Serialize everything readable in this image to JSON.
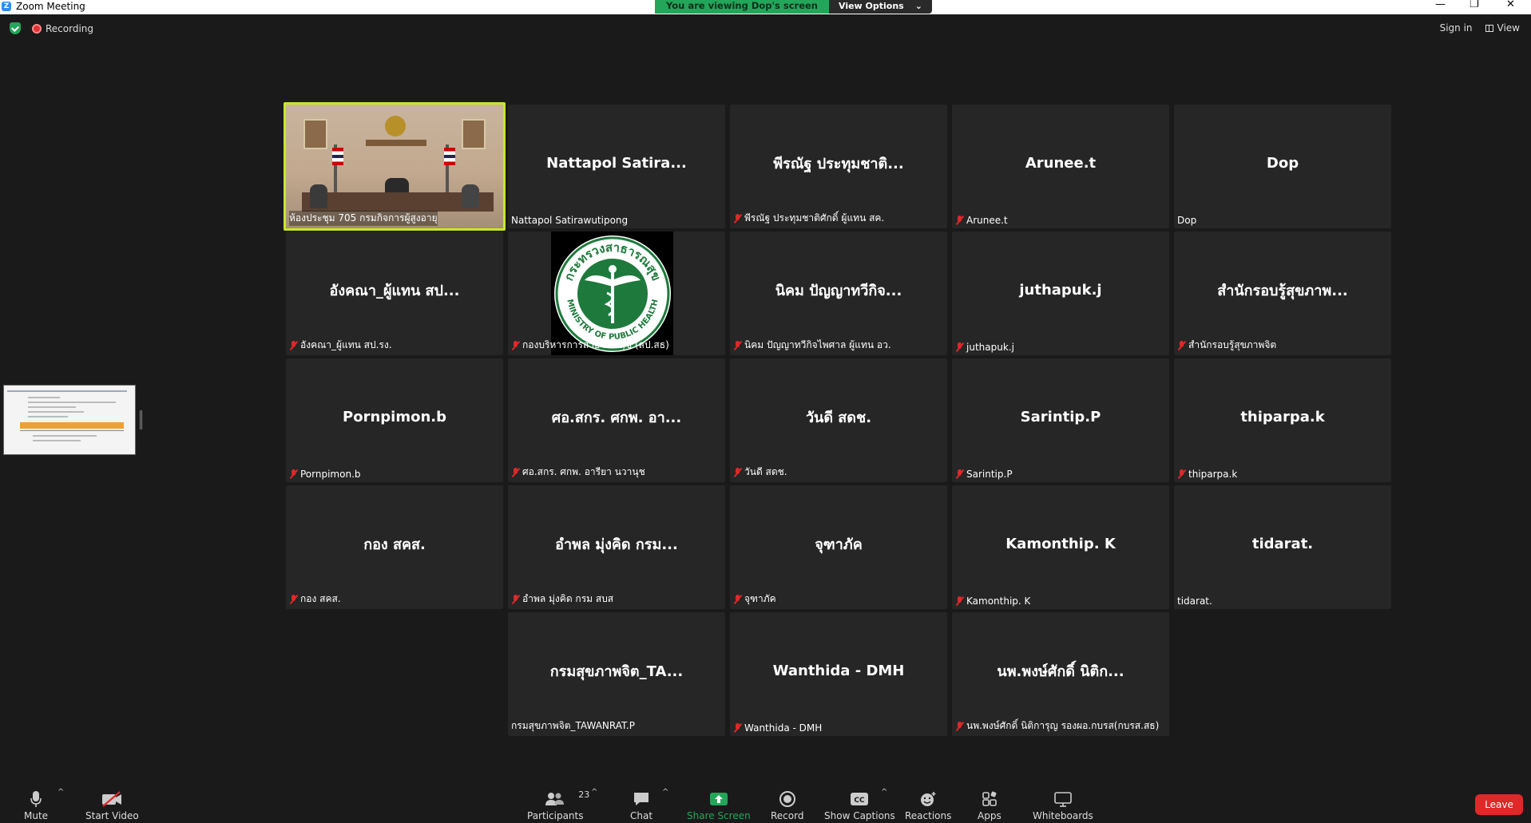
{
  "window": {
    "title": "Zoom Meeting"
  },
  "banner": {
    "viewing": "You are viewing Dop's screen",
    "view_options": "View Options",
    "chevron": "⌄"
  },
  "topbar": {
    "recording": "Recording",
    "sign_in": "Sign in",
    "view": "View"
  },
  "tiles": [
    {
      "big": "",
      "name": "ห้องประชุม 705 กรมกิจการผู้สูงอายุ",
      "muted": false,
      "video": "room"
    },
    {
      "big": "Nattapol Satira...",
      "name": "Nattapol Satirawutipong",
      "muted": false
    },
    {
      "big": "พีรณัฐ ประทุมชาติ...",
      "name": "พีรณัฐ ประทุมชาติศักดิ์ ผู้แทน สค.",
      "muted": true
    },
    {
      "big": "Arunee.t",
      "name": "Arunee.t",
      "muted": true
    },
    {
      "big": "Dop",
      "name": "Dop",
      "muted": false
    },
    {
      "big": "อังคณา_ผู้แทน สป...",
      "name": "อังคณา_ผู้แทน สป.รง.",
      "muted": true
    },
    {
      "big": "",
      "name": "กองบริหารการสาธารณสุข (สป.สธ)",
      "muted": true,
      "video": "logo"
    },
    {
      "big": "นิคม ปัญญาทวีกิจ...",
      "name": "นิคม ปัญญาทวีกิจไพศาล ผู้แทน อว.",
      "muted": true
    },
    {
      "big": "juthapuk.j",
      "name": "juthapuk.j",
      "muted": true
    },
    {
      "big": "สำนักรอบรู้สุขภาพ...",
      "name": "สำนักรอบรู้สุขภาพจิต",
      "muted": true
    },
    {
      "big": "Pornpimon.b",
      "name": "Pornpimon.b",
      "muted": true
    },
    {
      "big": "ศอ.สกร. ศกพ. อา...",
      "name": "ศอ.สกร. ศกพ. อารียา นวานุช",
      "muted": true
    },
    {
      "big": "วันดี สดช.",
      "name": "วันดี สดช.",
      "muted": true
    },
    {
      "big": "Sarintip.P",
      "name": "Sarintip.P",
      "muted": true
    },
    {
      "big": "thiparpa.k",
      "name": "thiparpa.k",
      "muted": true
    },
    {
      "big": "กอง สคส.",
      "name": "กอง สคส.",
      "muted": true
    },
    {
      "big": "อำพล มุ่งคิด  กรม...",
      "name": "อำพล มุ่งคิด  กรม สบส",
      "muted": true
    },
    {
      "big": "จุฑาภัค",
      "name": "จุฑาภัค",
      "muted": true
    },
    {
      "big": "Kamonthip. K",
      "name": "Kamonthip. K",
      "muted": true
    },
    {
      "big": "tidarat.",
      "name": "tidarat.",
      "muted": false
    },
    {
      "big": "กรมสุขภาพจิต_TA...",
      "name": "กรมสุขภาพจิต_TAWANRAT.P",
      "muted": false
    },
    {
      "big": "Wanthida - DMH",
      "name": "Wanthida - DMH",
      "muted": true
    },
    {
      "big": "นพ.พงษ์ศักดิ์ นิติก...",
      "name": "นพ.พงษ์ศักดิ์ นิติการุญ รองผอ.กบรส(กบรส.สธ)",
      "muted": true
    }
  ],
  "logo": {
    "top_text": "กระทรวงสาธารณสุข",
    "bottom_text": "MINISTRY OF PUBLIC HEALTH",
    "color": "#1e7a3c"
  },
  "toolbar": {
    "mute": "Mute",
    "start_video": "Start Video",
    "participants": "Participants",
    "participant_count": "23",
    "chat": "Chat",
    "share_screen": "Share Screen",
    "record": "Record",
    "show_captions": "Show Captions",
    "reactions": "Reactions",
    "apps": "Apps",
    "whiteboards": "Whiteboards",
    "leave": "Leave",
    "caret": "^"
  },
  "colors": {
    "accent_green": "#23a65a",
    "leave_red": "#e02828",
    "active_speaker": "#c8e62a"
  }
}
